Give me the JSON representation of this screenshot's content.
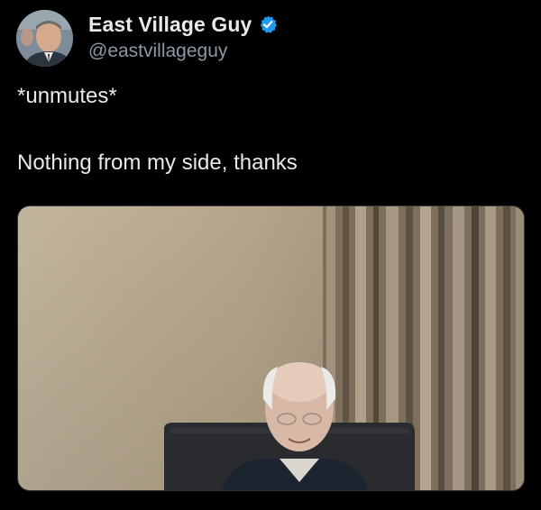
{
  "tweet": {
    "author": {
      "display_name": "East Village Guy",
      "handle": "@eastvillageguy",
      "verified": true,
      "avatar_icon": "profile-photo-icon",
      "verified_icon": "verified-badge-icon"
    },
    "text_line_1": "*unmutes*",
    "text_line_2": "Nothing from my side, thanks",
    "media": {
      "type": "photo",
      "icon": "video-call-photo"
    }
  },
  "colors": {
    "background": "#000000",
    "text_primary": "#e7e9ea",
    "text_secondary": "#8b98a5",
    "verified_blue": "#1d9bf0"
  }
}
